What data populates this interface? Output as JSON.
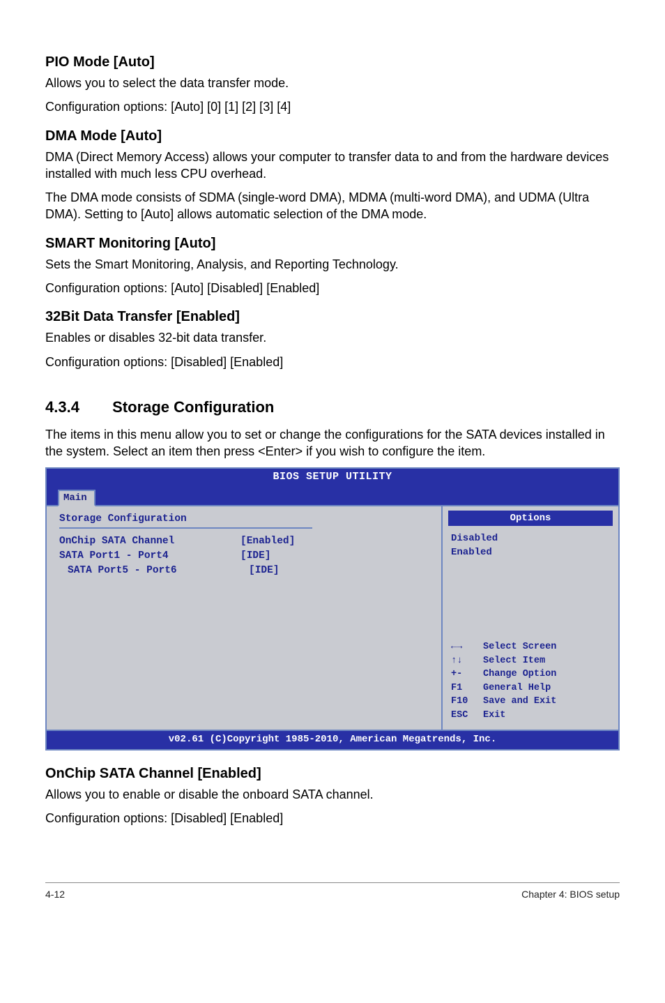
{
  "sections": {
    "pio": {
      "title": "PIO Mode [Auto]",
      "p1": "Allows you to select the data transfer mode.",
      "p2": "Configuration options: [Auto] [0] [1] [2] [3] [4]"
    },
    "dma": {
      "title": "DMA Mode [Auto]",
      "p1": "DMA (Direct Memory Access) allows your computer to transfer data to and from the hardware devices installed with much less CPU overhead.",
      "p2": "The DMA mode consists of SDMA (single-word DMA), MDMA (multi-word DMA), and UDMA (Ultra DMA). Setting to [Auto] allows automatic selection of the DMA mode."
    },
    "smart": {
      "title": "SMART Monitoring [Auto]",
      "p1": "Sets the Smart Monitoring, Analysis, and Reporting Technology.",
      "p2": "Configuration options: [Auto] [Disabled] [Enabled]"
    },
    "bit32": {
      "title": "32Bit Data Transfer [Enabled]",
      "p1": "Enables or disables 32-bit data transfer.",
      "p2": "Configuration options: [Disabled] [Enabled]"
    },
    "storage": {
      "num": "4.3.4",
      "title": "Storage Configuration",
      "p1": "The items in this menu allow you to set or change the configurations for the SATA devices installed in the system. Select an item then press <Enter> if you wish to configure the item."
    },
    "onchip": {
      "title": "OnChip SATA Channel [Enabled]",
      "p1": "Allows you to enable or disable the onboard SATA channel.",
      "p2": "Configuration options: [Disabled] [Enabled]"
    }
  },
  "bios": {
    "title": "BIOS SETUP UTILITY",
    "tab": "Main",
    "left_title": "Storage Configuration",
    "rows": [
      {
        "label": "OnChip SATA Channel",
        "value": "[Enabled]",
        "indent": false
      },
      {
        "label": "SATA Port1 - Port4",
        "value": "[IDE]",
        "indent": false
      },
      {
        "label": "SATA Port5 - Port6",
        "value": "[IDE]",
        "indent": true
      }
    ],
    "options_title": "Options",
    "options": [
      "Disabled",
      "Enabled"
    ],
    "help": [
      {
        "key": "←→",
        "desc": "Select Screen"
      },
      {
        "key": "↑↓",
        "desc": "Select Item"
      },
      {
        "key": "+-",
        "desc": "Change Option"
      },
      {
        "key": "F1",
        "desc": "General Help"
      },
      {
        "key": "F10",
        "desc": "Save and Exit"
      },
      {
        "key": "ESC",
        "desc": "Exit"
      }
    ],
    "footer": "v02.61 (C)Copyright 1985-2010, American Megatrends, Inc."
  },
  "footer": {
    "left": "4-12",
    "right": "Chapter 4: BIOS setup"
  }
}
